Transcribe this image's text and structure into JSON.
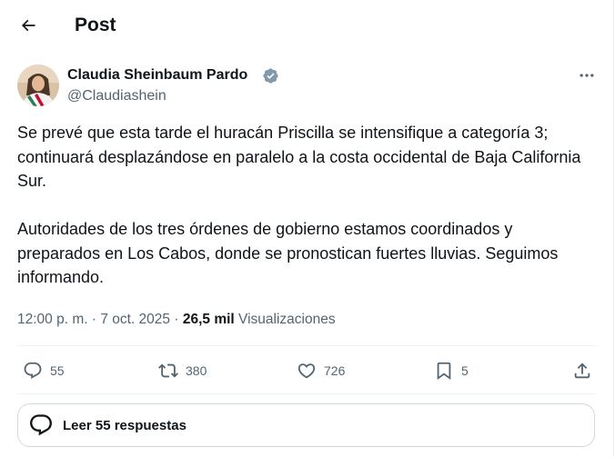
{
  "header": {
    "title": "Post",
    "back_icon": "arrow-left-icon"
  },
  "author": {
    "name": "Claudia Sheinbaum Pardo",
    "handle": "@Claudiashein",
    "verified": true,
    "verified_color": "#829aab"
  },
  "post": {
    "paragraphs": [
      "Se prevé que esta tarde el huracán Priscilla se intensifique a categoría 3; continuará desplazándose en paralelo a la costa occidental de Baja California Sur.",
      "Autoridades de los tres órdenes de gobierno estamos coordinados y preparados en Los Cabos, donde se pronostican fuertes lluvias. Seguimos informando."
    ],
    "time": "12:00 p. m.",
    "separator": "·",
    "date": "7 oct. 2025",
    "views_count": "26,5 mil",
    "views_label": "Visualizaciones"
  },
  "actions": {
    "replies": "55",
    "reposts": "380",
    "likes": "726",
    "bookmarks": "5"
  },
  "read_replies": {
    "label": "Leer 55 respuestas"
  },
  "colors": {
    "text": "#0f1419",
    "secondary": "#536471",
    "border": "#cfd9de",
    "divider": "#eff3f4"
  }
}
